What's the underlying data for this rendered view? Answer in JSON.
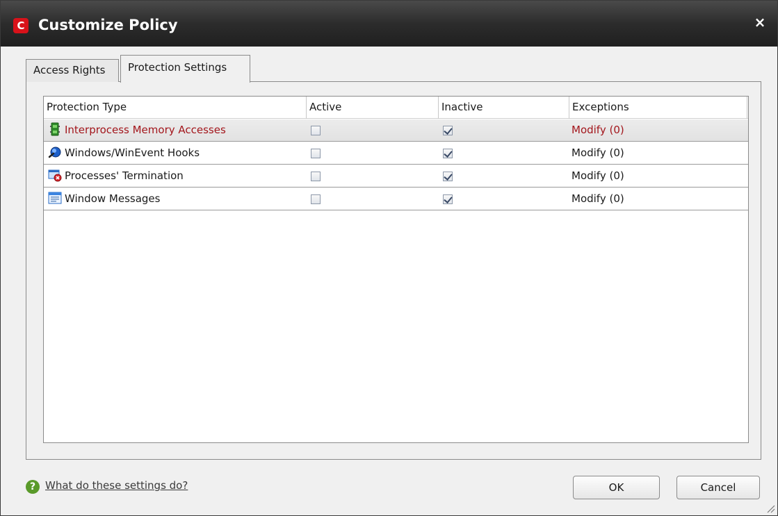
{
  "window": {
    "title": "Customize Policy",
    "logo_letter": "C",
    "close_glyph": "×"
  },
  "tabs": [
    {
      "label": "Access Rights",
      "active": false
    },
    {
      "label": "Protection Settings",
      "active": true
    }
  ],
  "table": {
    "columns": [
      "Protection Type",
      "Active",
      "Inactive",
      "Exceptions"
    ],
    "rows": [
      {
        "icon": "memory-chip-icon",
        "name": "Interprocess Memory Accesses",
        "active": false,
        "inactive": true,
        "exceptions": "Modify (0)",
        "selected": true
      },
      {
        "icon": "hook-globe-icon",
        "name": "Windows/WinEvent Hooks",
        "active": false,
        "inactive": true,
        "exceptions": "Modify (0)",
        "selected": false
      },
      {
        "icon": "process-terminate-icon",
        "name": "Processes' Termination",
        "active": false,
        "inactive": true,
        "exceptions": "Modify (0)",
        "selected": false
      },
      {
        "icon": "window-messages-icon",
        "name": "Window Messages",
        "active": false,
        "inactive": true,
        "exceptions": "Modify (0)",
        "selected": false
      }
    ]
  },
  "footer": {
    "help_glyph": "?",
    "help_link": "What do these settings do?",
    "ok_label": "OK",
    "cancel_label": "Cancel"
  },
  "colors": {
    "selected_text": "#a3161c",
    "title_bar": "#2c2c2c",
    "logo_red": "#d8121a"
  }
}
